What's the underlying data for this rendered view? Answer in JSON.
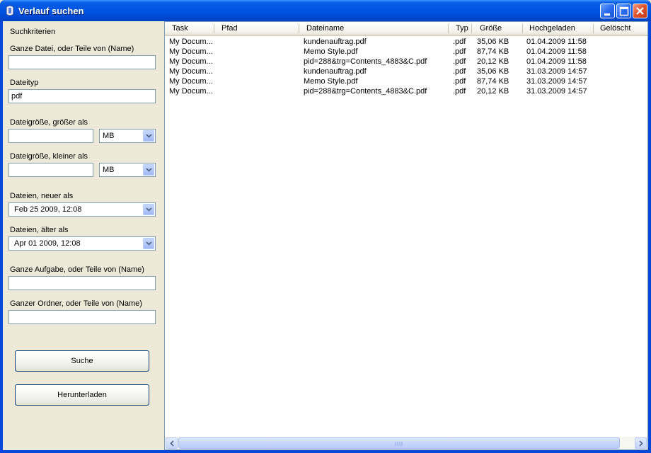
{
  "window": {
    "title": "Verlauf suchen"
  },
  "criteria": {
    "heading": "Suchkriterien",
    "name_label": "Ganze Datei, oder Teile von (Name)",
    "name_value": "",
    "type_label": "Dateityp",
    "type_value": "pdf",
    "size_greater_label": "Dateigröße, größer als",
    "size_greater_value": "",
    "size_greater_unit": "MB",
    "size_smaller_label": "Dateigröße, kleiner als",
    "size_smaller_value": "",
    "size_smaller_unit": "MB",
    "newer_label": "Dateien, neuer als",
    "newer_value": "Feb 25  2009,  12:08",
    "older_label": "Dateien, älter als",
    "older_value": "Apr 01  2009,  12:08",
    "task_label": "Ganze Aufgabe, oder Teile von (Name)",
    "task_value": "",
    "folder_label": "Ganzer Ordner, oder Teile von (Name)",
    "folder_value": ""
  },
  "buttons": {
    "search": "Suche",
    "download": "Herunterladen"
  },
  "columns": [
    "Task",
    "Pfad",
    "Dateiname",
    "Typ",
    "Größe",
    "Hochgeladen",
    "Gelöscht"
  ],
  "rows": [
    [
      "My Docum...",
      "",
      "kundenauftrag.pdf",
      ".pdf",
      "35,06 KB",
      "01.04.2009 11:58",
      ""
    ],
    [
      "My Docum...",
      "",
      "Memo Style.pdf",
      ".pdf",
      "87,74 KB",
      "01.04.2009 11:58",
      ""
    ],
    [
      "My Docum...",
      "",
      "pid=288&trg=Contents_4883&C.pdf",
      ".pdf",
      "20,12 KB",
      "01.04.2009 11:58",
      ""
    ],
    [
      "My Docum...",
      "",
      "kundenauftrag.pdf",
      ".pdf",
      "35,06 KB",
      "31.03.2009 14:57",
      ""
    ],
    [
      "My Docum...",
      "",
      "Memo Style.pdf",
      ".pdf",
      "87,74 KB",
      "31.03.2009 14:57",
      ""
    ],
    [
      "My Docum...",
      "",
      "pid=288&trg=Contents_4883&C.pdf",
      ".pdf",
      "20,12 KB",
      "31.03.2009 14:57",
      ""
    ]
  ]
}
